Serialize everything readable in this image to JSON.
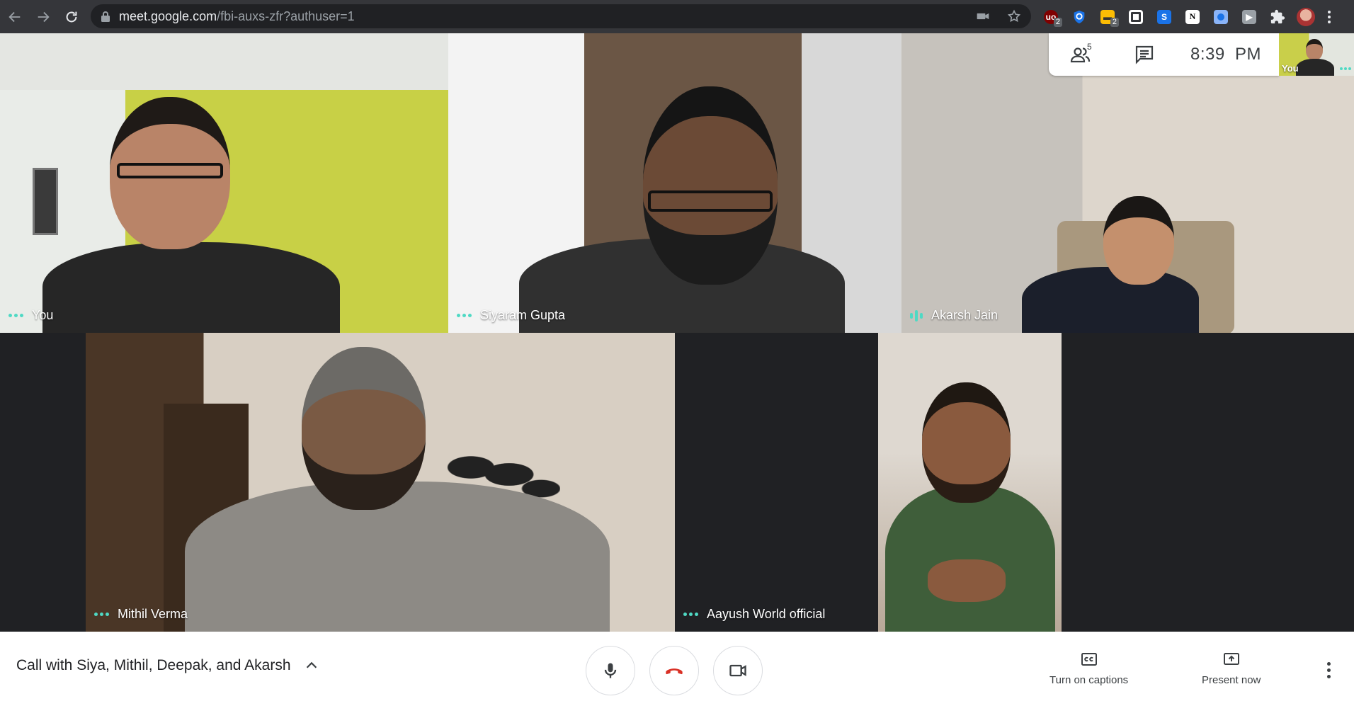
{
  "browser": {
    "url_host": "meet.google.com",
    "url_path": "/fbi-auxs-zfr?authuser=1",
    "extension_badges": [
      "2",
      "2"
    ]
  },
  "participants": [
    {
      "name": "You",
      "indicator": "dots"
    },
    {
      "name": "Siyaram Gupta",
      "indicator": "dots"
    },
    {
      "name": "Akarsh Jain",
      "indicator": "speaking"
    },
    {
      "name": "Mithil Verma",
      "indicator": "dots"
    },
    {
      "name": "Aayush World official",
      "indicator": "dots"
    }
  ],
  "info_panel": {
    "participant_count": "5",
    "time": "8:39  PM",
    "self_view_label": "You"
  },
  "bottom_bar": {
    "meeting_title": "Call with Siya, Mithil, Deepak, and Akarsh",
    "captions_label": "Turn on captions",
    "present_label": "Present now"
  },
  "colors": {
    "hangup_red": "#d93025",
    "speaking_teal": "#4fd9c4",
    "chrome_bg": "#35363a"
  }
}
